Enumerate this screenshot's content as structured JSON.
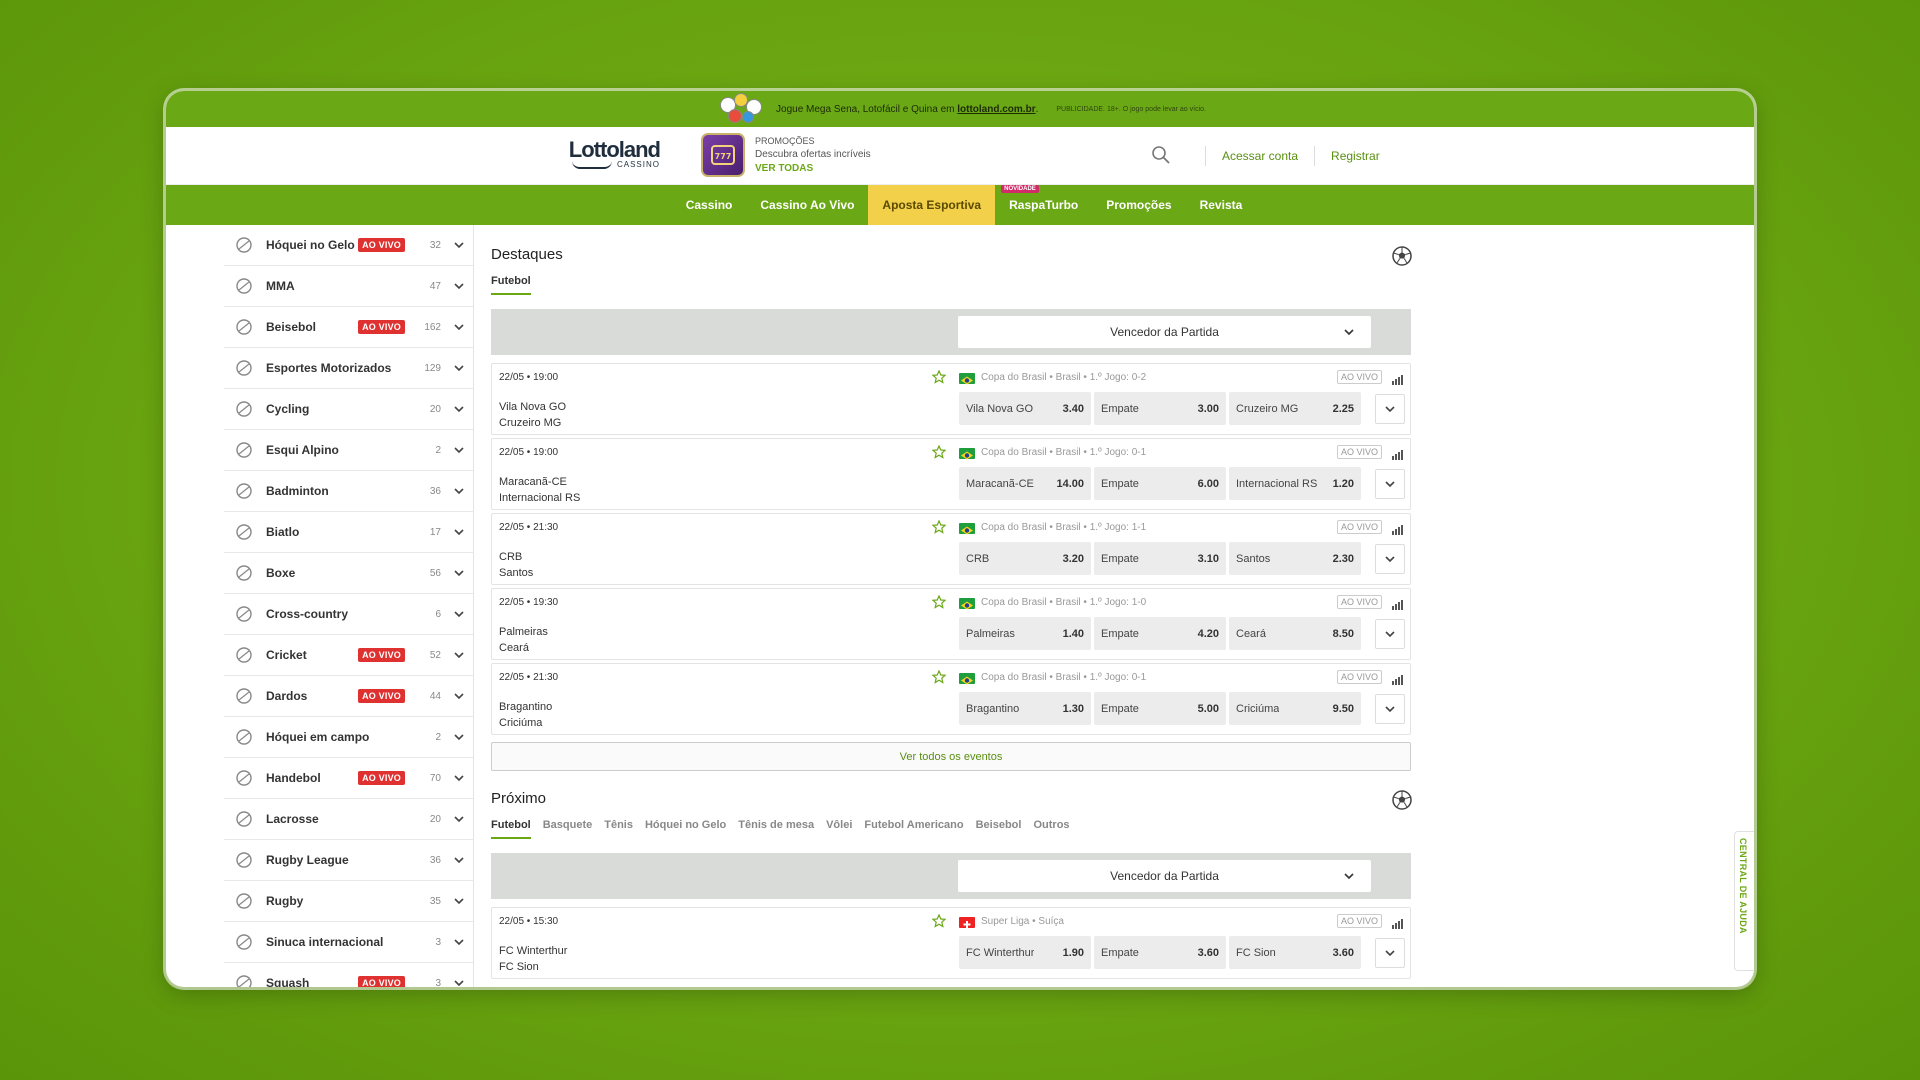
{
  "promo_strip": {
    "text_prefix": "Jogue Mega Sena, Lotofácil e Quina em ",
    "link": "lottoland.com.br",
    "text_suffix": ".",
    "disclaimer": "PUBLICIDADE. 18+. O jogo pode levar ao vício."
  },
  "header": {
    "brand": "Lottoland",
    "brand_sub": "CASSINO",
    "promo_label": "PROMOÇÕES",
    "promo_desc": "Descubra ofertas incríveis",
    "promo_link": "VER TODAS",
    "login": "Acessar conta",
    "register": "Registrar"
  },
  "nav": {
    "items": [
      {
        "label": "Cassino"
      },
      {
        "label": "Cassino Ao Vivo"
      },
      {
        "label": "Aposta Esportiva",
        "active": true
      },
      {
        "label": "RaspaTurbo",
        "badge": "NOVIDADE"
      },
      {
        "label": "Promoções"
      },
      {
        "label": "Revista"
      }
    ]
  },
  "live_badge": "AO VIVO",
  "sidebar": {
    "items": [
      {
        "label": "Hóquei no Gelo",
        "live": true,
        "count": "32"
      },
      {
        "label": "MMA",
        "live": false,
        "count": "47"
      },
      {
        "label": "Beisebol",
        "live": true,
        "count": "162"
      },
      {
        "label": "Esportes Motorizados",
        "live": false,
        "count": "129"
      },
      {
        "label": "Cycling",
        "live": false,
        "count": "20"
      },
      {
        "label": "Esqui Alpino",
        "live": false,
        "count": "2"
      },
      {
        "label": "Badminton",
        "live": false,
        "count": "36"
      },
      {
        "label": "Biatlo",
        "live": false,
        "count": "17"
      },
      {
        "label": "Boxe",
        "live": false,
        "count": "56"
      },
      {
        "label": "Cross-country",
        "live": false,
        "count": "6"
      },
      {
        "label": "Cricket",
        "live": true,
        "count": "52"
      },
      {
        "label": "Dardos",
        "live": true,
        "count": "44"
      },
      {
        "label": "Hóquei em campo",
        "live": false,
        "count": "2"
      },
      {
        "label": "Handebol",
        "live": true,
        "count": "70"
      },
      {
        "label": "Lacrosse",
        "live": false,
        "count": "20"
      },
      {
        "label": "Rugby League",
        "live": false,
        "count": "36"
      },
      {
        "label": "Rugby",
        "live": false,
        "count": "35"
      },
      {
        "label": "Sinuca internacional",
        "live": false,
        "count": "3"
      },
      {
        "label": "Squash",
        "live": true,
        "count": "3"
      }
    ]
  },
  "highlights": {
    "title": "Destaques",
    "tab": "Futebol",
    "market": "Vencedor da Partida",
    "see_all": "Ver todos os eventos",
    "events": [
      {
        "time": "22/05 • 19:00",
        "league": "Copa do Brasil • Brasil • 1.º Jogo: 0-2",
        "home": "Vila Nova GO",
        "away": "Cruzeiro MG",
        "odds": [
          {
            "n": "Vila Nova GO",
            "v": "3.40"
          },
          {
            "n": "Empate",
            "v": "3.00"
          },
          {
            "n": "Cruzeiro MG",
            "v": "2.25"
          }
        ]
      },
      {
        "time": "22/05 • 19:00",
        "league": "Copa do Brasil • Brasil • 1.º Jogo: 0-1",
        "home": "Maracanã-CE",
        "away": "Internacional RS",
        "odds": [
          {
            "n": "Maracanã-CE",
            "v": "14.00"
          },
          {
            "n": "Empate",
            "v": "6.00"
          },
          {
            "n": "Internacional RS",
            "v": "1.20"
          }
        ]
      },
      {
        "time": "22/05 • 21:30",
        "league": "Copa do Brasil • Brasil • 1.º Jogo: 1-1",
        "home": "CRB",
        "away": "Santos",
        "odds": [
          {
            "n": "CRB",
            "v": "3.20"
          },
          {
            "n": "Empate",
            "v": "3.10"
          },
          {
            "n": "Santos",
            "v": "2.30"
          }
        ]
      },
      {
        "time": "22/05 • 19:30",
        "league": "Copa do Brasil • Brasil • 1.º Jogo: 1-0",
        "home": "Palmeiras",
        "away": "Ceará",
        "odds": [
          {
            "n": "Palmeiras",
            "v": "1.40"
          },
          {
            "n": "Empate",
            "v": "4.20"
          },
          {
            "n": "Ceará",
            "v": "8.50"
          }
        ]
      },
      {
        "time": "22/05 • 21:30",
        "league": "Copa do Brasil • Brasil • 1.º Jogo: 0-1",
        "home": "Bragantino",
        "away": "Criciúma",
        "odds": [
          {
            "n": "Bragantino",
            "v": "1.30"
          },
          {
            "n": "Empate",
            "v": "5.00"
          },
          {
            "n": "Criciúma",
            "v": "9.50"
          }
        ]
      }
    ]
  },
  "upcoming": {
    "title": "Próximo",
    "tabs": [
      "Futebol",
      "Basquete",
      "Tênis",
      "Hóquei no Gelo",
      "Tênis de mesa",
      "Vôlei",
      "Futebol Americano",
      "Beisebol",
      "Outros"
    ],
    "market": "Vencedor da Partida",
    "events": [
      {
        "time": "22/05 • 15:30",
        "league": "Super Liga • Suíça",
        "home": "FC Winterthur",
        "away": "FC Sion",
        "odds": [
          {
            "n": "FC Winterthur",
            "v": "1.90"
          },
          {
            "n": "Empate",
            "v": "3.60"
          },
          {
            "n": "FC Sion",
            "v": "3.60"
          }
        ]
      }
    ]
  },
  "help_tab": "CENTRAL DE AJUDA",
  "colors": {
    "brand_green": "#6ba815",
    "active_nav": "#f2d04a",
    "live_red": "#e03131"
  }
}
